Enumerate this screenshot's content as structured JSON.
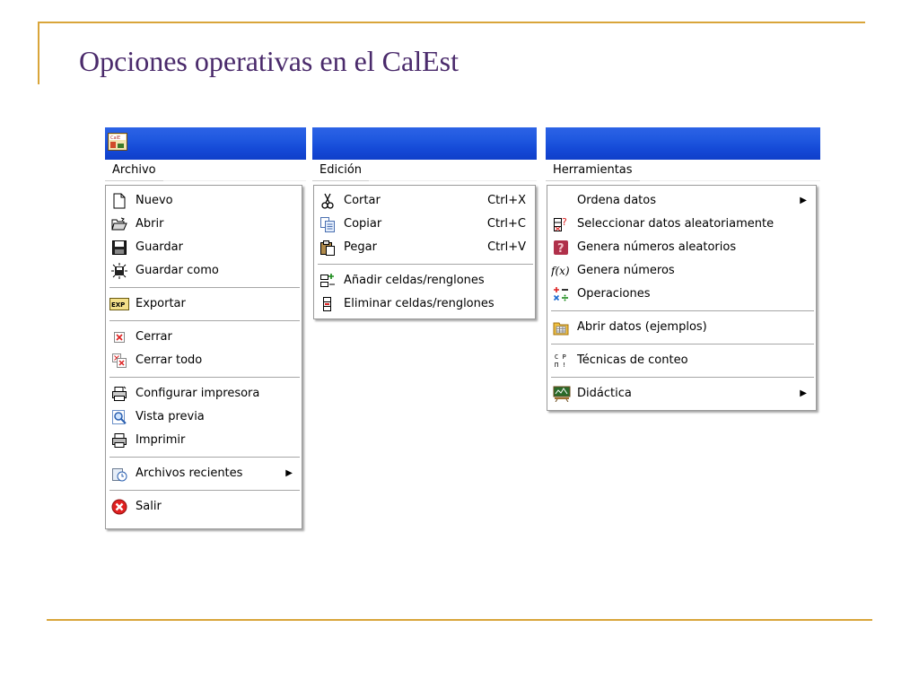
{
  "slide": {
    "title": "Opciones operativas en el CalEst"
  },
  "archivo": {
    "menu_title": "Archivo",
    "items": [
      {
        "label": "Nuevo",
        "icon": "new-document-icon"
      },
      {
        "label": "Abrir",
        "icon": "open-folder-icon"
      },
      {
        "label": "Guardar",
        "icon": "save-floppy-icon"
      },
      {
        "label": "Guardar como",
        "icon": "save-as-icon"
      },
      {
        "label": "Exportar",
        "icon": "export-icon"
      },
      {
        "label": "Cerrar",
        "icon": "close-icon"
      },
      {
        "label": "Cerrar todo",
        "icon": "close-all-icon"
      },
      {
        "label": "Configurar impresora",
        "icon": "printer-setup-icon"
      },
      {
        "label": "Vista previa",
        "icon": "print-preview-icon"
      },
      {
        "label": "Imprimir",
        "icon": "printer-icon"
      },
      {
        "label": "Archivos recientes",
        "icon": "recent-files-icon"
      },
      {
        "label": "Salir",
        "icon": "exit-icon"
      }
    ],
    "export_icon_text": "EXP"
  },
  "edicion": {
    "menu_title": "Edición",
    "items": [
      {
        "label": "Cortar",
        "shortcut": "Ctrl+X",
        "icon": "scissors-icon"
      },
      {
        "label": "Copiar",
        "shortcut": "Ctrl+C",
        "icon": "copy-icon"
      },
      {
        "label": "Pegar",
        "shortcut": "Ctrl+V",
        "icon": "paste-icon"
      },
      {
        "label": "Añadir celdas/renglones",
        "icon": "add-cells-icon"
      },
      {
        "label": "Eliminar celdas/renglones",
        "icon": "delete-cells-icon"
      }
    ]
  },
  "herramientas": {
    "menu_title": "Herramientas",
    "items": [
      {
        "label": "Ordena datos",
        "icon": "none"
      },
      {
        "label": "Seleccionar datos aleatoriamente",
        "icon": "random-select-icon"
      },
      {
        "label": "Genera números aleatorios",
        "icon": "random-numbers-icon"
      },
      {
        "label": "Genera números",
        "icon": "function-icon",
        "icon_text": "f(x)"
      },
      {
        "label": "Operaciones",
        "icon": "operations-icon"
      },
      {
        "label": "Abrir datos (ejemplos)",
        "icon": "open-data-icon"
      },
      {
        "label": "Técnicas de conteo",
        "icon": "counting-icon",
        "icon_text_top": "C P",
        "icon_text_bottom": "Π !"
      },
      {
        "label": "Didáctica",
        "icon": "didactic-icon"
      }
    ]
  },
  "colors": {
    "accent_line": "#d9a53a",
    "title_text": "#4a2a6b",
    "titlebar_blue": "#1f56de"
  }
}
